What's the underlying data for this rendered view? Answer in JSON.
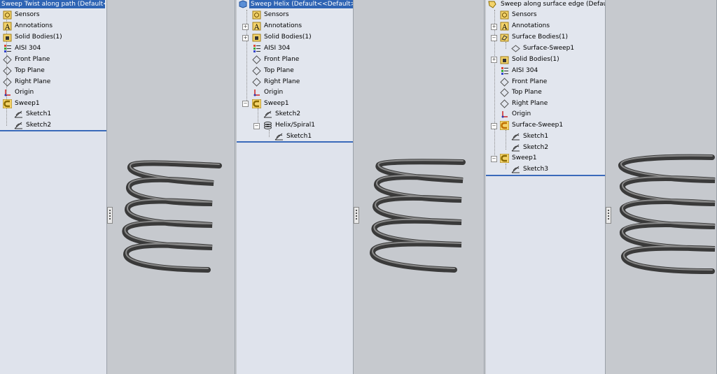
{
  "colors": {
    "title_bg": "#2e64b4",
    "view_bg": "#c6c9ce",
    "tree_bg": "#e2e6ee",
    "spring": "#4a4a4a"
  },
  "panels": [
    {
      "title": "Sweep Twist along path  (Default<",
      "title_selected": true,
      "items": [
        {
          "label": "Sensors",
          "icon": "sensors-icon"
        },
        {
          "label": "Annotations",
          "icon": "annotations-icon"
        },
        {
          "label": "Solid Bodies(1)",
          "icon": "solid-bodies-icon"
        },
        {
          "label": "AISI 304",
          "icon": "material-icon"
        },
        {
          "label": "Front Plane",
          "icon": "plane-icon"
        },
        {
          "label": "Top Plane",
          "icon": "plane-icon"
        },
        {
          "label": "Right Plane",
          "icon": "plane-icon"
        },
        {
          "label": "Origin",
          "icon": "origin-icon"
        },
        {
          "label": "Sweep1",
          "icon": "sweep-icon"
        },
        {
          "label": "Sketch1",
          "icon": "sketch-icon"
        },
        {
          "label": "Sketch2",
          "icon": "sketch-icon"
        }
      ]
    },
    {
      "title": "Sweep Helix  (Default<<Default>",
      "title_selected": true,
      "items": [
        {
          "label": "Sensors",
          "icon": "sensors-icon"
        },
        {
          "label": "Annotations",
          "icon": "annotations-icon"
        },
        {
          "label": "Solid Bodies(1)",
          "icon": "solid-bodies-icon"
        },
        {
          "label": "AISI 304",
          "icon": "material-icon"
        },
        {
          "label": "Front Plane",
          "icon": "plane-icon"
        },
        {
          "label": "Top Plane",
          "icon": "plane-icon"
        },
        {
          "label": "Right Plane",
          "icon": "plane-icon"
        },
        {
          "label": "Origin",
          "icon": "origin-icon"
        },
        {
          "label": "Sweep1",
          "icon": "sweep-icon"
        },
        {
          "label": "Sketch2",
          "icon": "sketch-icon"
        },
        {
          "label": "Helix/Spiral1",
          "icon": "helix-icon"
        },
        {
          "label": "Sketch1",
          "icon": "sketch-icon"
        }
      ]
    },
    {
      "title": "Sweep along surface edge  (Defaul",
      "title_selected": false,
      "items": [
        {
          "label": "Sensors",
          "icon": "sensors-icon"
        },
        {
          "label": "Annotations",
          "icon": "annotations-icon"
        },
        {
          "label": "Surface Bodies(1)",
          "icon": "surface-bodies-icon"
        },
        {
          "label": "Surface-Sweep1",
          "icon": "surface-icon"
        },
        {
          "label": "Solid Bodies(1)",
          "icon": "solid-bodies-icon"
        },
        {
          "label": "AISI 304",
          "icon": "material-icon"
        },
        {
          "label": "Front Plane",
          "icon": "plane-icon"
        },
        {
          "label": "Top Plane",
          "icon": "plane-icon"
        },
        {
          "label": "Right Plane",
          "icon": "plane-icon"
        },
        {
          "label": "Origin",
          "icon": "origin-icon"
        },
        {
          "label": "Surface-Sweep1",
          "icon": "sweep-icon"
        },
        {
          "label": "Sketch1",
          "icon": "sketch-icon"
        },
        {
          "label": "Sketch2",
          "icon": "sketch-icon"
        },
        {
          "label": "Sweep1",
          "icon": "sweep-icon"
        },
        {
          "label": "Sketch3",
          "icon": "sketch-icon"
        }
      ]
    }
  ]
}
